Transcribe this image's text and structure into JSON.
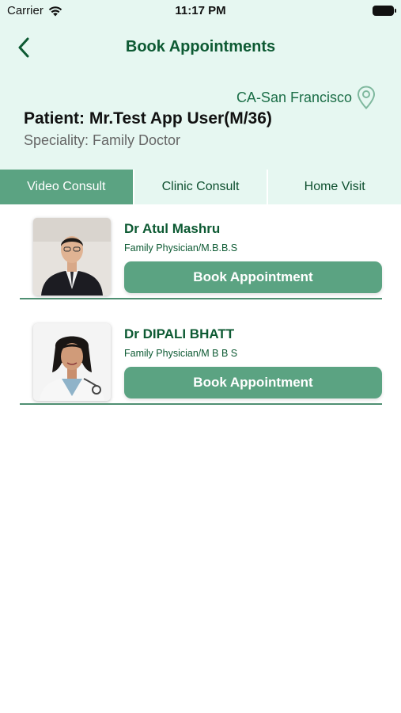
{
  "status_bar": {
    "carrier": "Carrier",
    "time": "11:17 PM"
  },
  "header": {
    "title": "Book Appointments",
    "location": "CA-San Francisco",
    "patient": "Patient: Mr.Test App User(M/36)",
    "speciality": "Speciality: Family Doctor"
  },
  "tabs": [
    {
      "label": "Video Consult",
      "active": true
    },
    {
      "label": "Clinic Consult",
      "active": false
    },
    {
      "label": "Home Visit",
      "active": false
    }
  ],
  "doctors": [
    {
      "name": "Dr Atul Mashru",
      "qualification": "Family Physician/M.B.B.S",
      "button_label": "Book Appointment"
    },
    {
      "name": "Dr DIPALI BHATT",
      "qualification": "Family Physician/M B B S",
      "button_label": "Book Appointment"
    }
  ],
  "colors": {
    "header_bg": "#e6f7f1",
    "accent": "#5ba382",
    "title": "#0d5a33"
  }
}
